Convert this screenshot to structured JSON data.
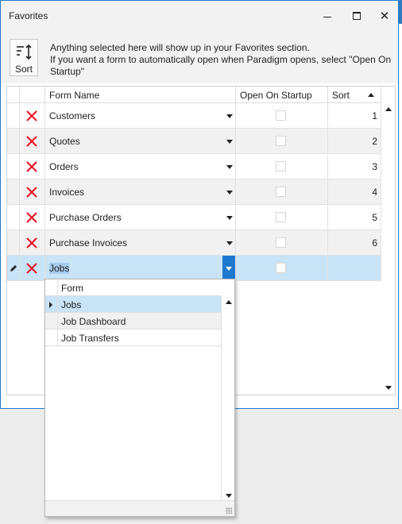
{
  "window": {
    "title": "Favorites"
  },
  "toolbar": {
    "sort_label": "Sort",
    "info_line1": "Anything selected here will show up in your Favorites section.",
    "info_line2": "If you want a form to automatically open when Paradigm opens, select \"Open On Startup\""
  },
  "grid": {
    "columns": [
      "Form Name",
      "Open On Startup",
      "Sort"
    ],
    "rows": [
      {
        "name": "Customers",
        "open_on_startup": false,
        "sort": "1"
      },
      {
        "name": "Quotes",
        "open_on_startup": false,
        "sort": "2"
      },
      {
        "name": "Orders",
        "open_on_startup": false,
        "sort": "3"
      },
      {
        "name": "Invoices",
        "open_on_startup": false,
        "sort": "4"
      },
      {
        "name": "Purchase Orders",
        "open_on_startup": false,
        "sort": "5"
      },
      {
        "name": "Purchase Invoices",
        "open_on_startup": false,
        "sort": "6"
      }
    ],
    "editing_row": {
      "name": "Jobs",
      "open_on_startup": false,
      "sort": ""
    }
  },
  "dropdown": {
    "header": "Form",
    "options": [
      "Jobs",
      "Job Dashboard",
      "Job Transfers"
    ],
    "selected": "Jobs"
  },
  "colors": {
    "accent": "#1d78d0",
    "selection": "#c9e3f7",
    "delete_x": "#e81123"
  }
}
